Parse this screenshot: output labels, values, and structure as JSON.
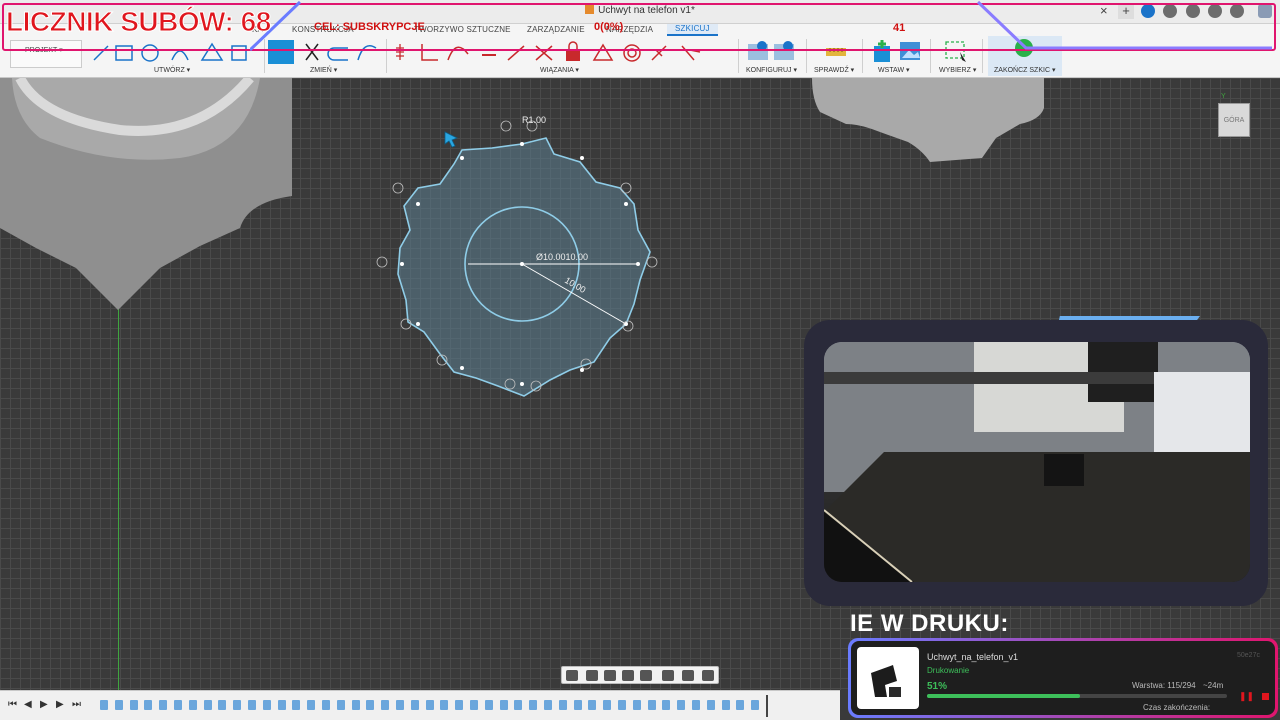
{
  "window": {
    "title": "Uchwyt na telefon v1*",
    "close_label": "×",
    "new_tab_label": "+"
  },
  "ribbon": {
    "tabs": [
      {
        "label": "KONSTRUKCJA"
      },
      {
        "label": "TWORZYWO SZTUCZNE"
      },
      {
        "label": "ZARZĄDZANIE"
      },
      {
        "label": "NARZĘDZIA"
      },
      {
        "label": "SZKICUJ"
      }
    ],
    "partial_tab": "KA",
    "design_label": "PROJEKT ▾",
    "groups": {
      "create": "UTWÓRZ ▾",
      "modify": "ZMIEŃ ▾",
      "constraints": "WIĄZANIA ▾",
      "configure": "KONFIGURUJ ▾",
      "inspect": "SPRAWDŹ ▾",
      "insert": "WSTAW ▾",
      "select": "WYBIERZ ▾",
      "finish": "ZAKOŃCZ SZKIC ▾"
    }
  },
  "overlay": {
    "subs_counter": "LICZNIK SUBÓW: 68",
    "goal_label": "CEL: SUBSKRYPCJE",
    "goal_progress": "0(0%)",
    "number": "41",
    "printing_heading": "IE W DRUKU:"
  },
  "sketch": {
    "dim_radius": "R1.00",
    "dim_diameter": "Ø10.00",
    "dim_width": "10.00",
    "dim_diag": "10.00"
  },
  "viewcube": {
    "face": "GÓRA",
    "axis": "Y"
  },
  "print_job": {
    "name": "Uchwyt_na_telefon_v1",
    "status": "Drukowanie",
    "percent": "51%",
    "progress_fraction": 0.51,
    "layer": "Warstwa: 115/294",
    "eta": "~24m",
    "finish_label": "Czas zakończenia:",
    "job_id": "50e27c"
  },
  "colors": {
    "accent": "#1a73c9",
    "overlay_red": "#e0161e",
    "overlay_frame": "#e0156e",
    "sketch_line": "#7fc4f2",
    "progress": "#3dbf5a"
  }
}
